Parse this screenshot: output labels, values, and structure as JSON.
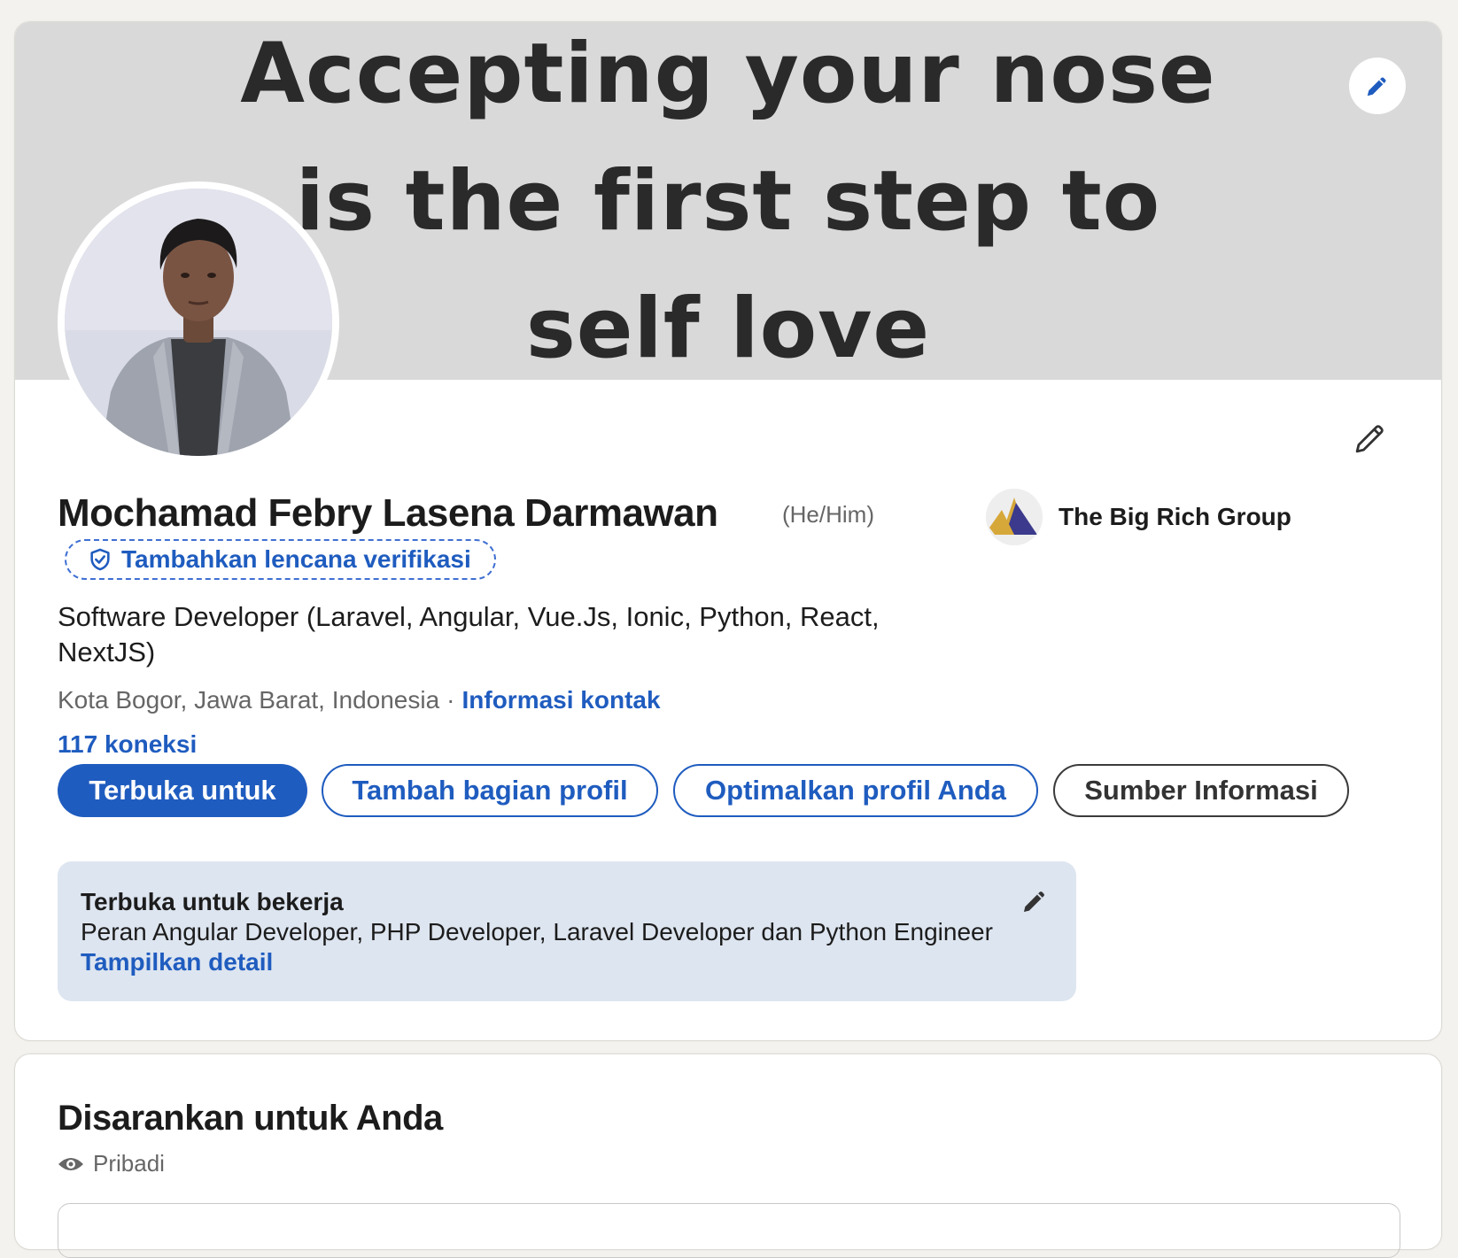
{
  "banner": {
    "lines": [
      "Accepting your nose",
      "is the first step to",
      "self love"
    ],
    "edit_icon": "pencil-icon"
  },
  "profile": {
    "name": "Mochamad Febry Lasena Darmawan",
    "pronouns": "(He/Him)",
    "verification_label": "Tambahkan lencana verifikasi",
    "headline": "Software Developer (Laravel, Angular, Vue.Js, Ionic, Python, React, NextJS)",
    "location": "Kota Bogor, Jawa Barat, Indonesia",
    "separator": "·",
    "contact_info": "Informasi kontak",
    "connections": "117 koneksi",
    "company": "The Big Rich Group"
  },
  "actions": {
    "open_to": "Terbuka untuk",
    "add_section": "Tambah bagian profil",
    "optimize": "Optimalkan profil Anda",
    "resources": "Sumber Informasi"
  },
  "open_to_work": {
    "title": "Terbuka untuk bekerja",
    "roles": "Peran Angular Developer, PHP Developer, Laravel Developer dan Python Engineer",
    "details_link": "Tampilkan detail"
  },
  "suggested": {
    "title": "Disarankan untuk Anda",
    "privacy": "Pribadi"
  },
  "colors": {
    "accent": "#1f5cbf",
    "background": "#f4f2ee",
    "banner": "#d9d9d9",
    "open_work_box": "#dde5f0"
  }
}
